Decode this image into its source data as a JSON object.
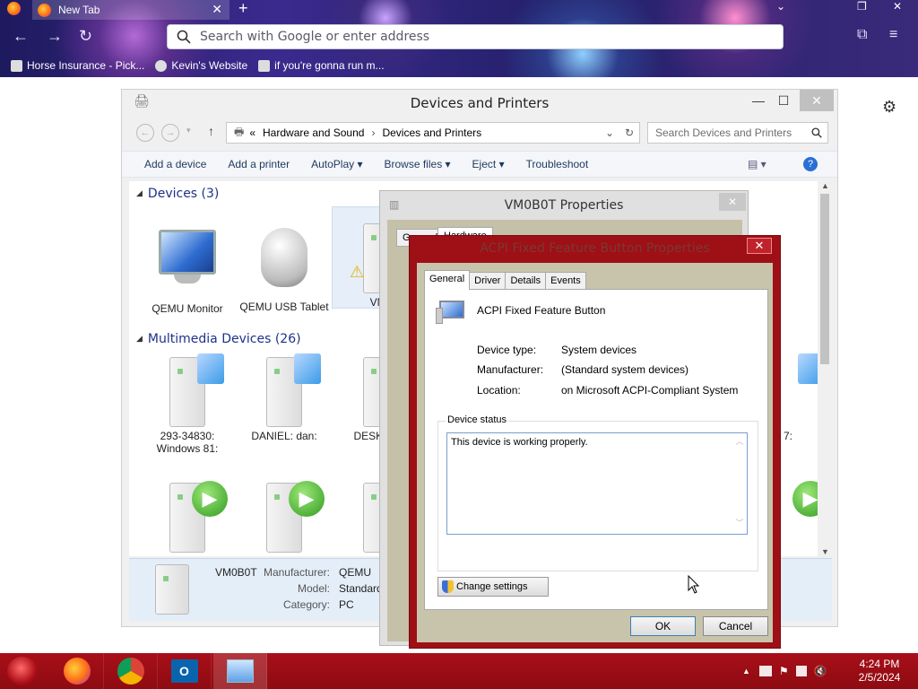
{
  "browser": {
    "tab_title": "New Tab",
    "url_placeholder": "Search with Google or enter address",
    "bookmarks": [
      "Horse Insurance - Pick...",
      "Kevin's Website",
      "if you're gonna run m..."
    ]
  },
  "devices_window": {
    "title": "Devices and Printers",
    "breadcrumb": [
      "«",
      "Hardware and Sound",
      "Devices and Printers"
    ],
    "search_placeholder": "Search Devices and Printers",
    "commands": [
      "Add a device",
      "Add a printer",
      "AutoPlay",
      "Browse files",
      "Eject",
      "Troubleshoot"
    ],
    "groups": [
      {
        "header": "Devices (3)",
        "items": [
          "QEMU Monitor",
          "QEMU USB Tablet",
          "VM0"
        ]
      },
      {
        "header": "Multimedia Devices (26)",
        "items": [
          "293-34830: Windows 81:",
          "DANIEL: dan:",
          "DESKTO U",
          "7:"
        ]
      }
    ],
    "details": {
      "name": "VM0B0T",
      "manufacturer_label": "Manufacturer:",
      "manufacturer_value": "QEMU",
      "model_label": "Model:",
      "model_value": "Standard",
      "category_label": "Category:",
      "category_value": "PC"
    }
  },
  "vm_properties": {
    "title": "VM0B0T Properties",
    "tabs": [
      "General",
      "Hardware"
    ]
  },
  "acpi_dialog": {
    "title": "ACPI Fixed Feature Button Properties",
    "tabs": [
      "General",
      "Driver",
      "Details",
      "Events"
    ],
    "device_name": "ACPI Fixed Feature Button",
    "device_type_label": "Device type:",
    "device_type_value": "System devices",
    "manufacturer_label": "Manufacturer:",
    "manufacturer_value": "(Standard system devices)",
    "location_label": "Location:",
    "location_value": "on Microsoft ACPI-Compliant System",
    "status_legend": "Device status",
    "status_text": "This device is working properly.",
    "change_settings": "Change settings",
    "ok": "OK",
    "cancel": "Cancel"
  },
  "taskbar": {
    "time": "4:24 PM",
    "date": "2/5/2024"
  }
}
